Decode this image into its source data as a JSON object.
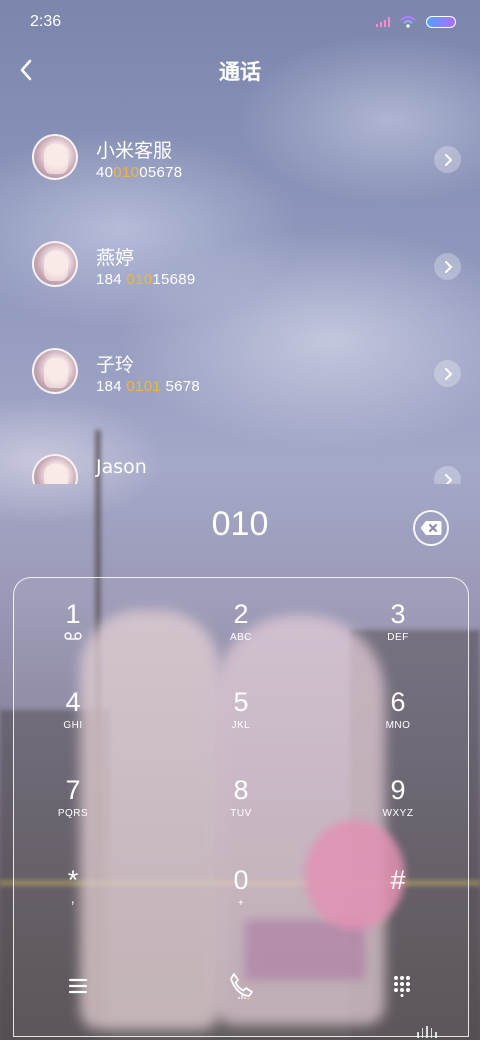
{
  "status_bar": {
    "time": "2:36"
  },
  "header": {
    "title": "通话"
  },
  "contacts": [
    {
      "name": "小米客服",
      "number_parts": [
        "40",
        "010",
        "05678"
      ]
    },
    {
      "name": "燕婷",
      "number_parts": [
        "184 ",
        "010",
        "15689"
      ]
    },
    {
      "name": "子玲",
      "number_parts": [
        "184 ",
        "0101",
        " 5678"
      ]
    },
    {
      "name": "Jason",
      "number_parts": [
        "",
        "",
        ""
      ]
    }
  ],
  "colors": {
    "highlight": "#f6b23a",
    "text": "#ffffff"
  },
  "dialer": {
    "input": "010"
  },
  "keys": [
    {
      "num": "1",
      "sub": "voicemail-icon"
    },
    {
      "num": "2",
      "sub": "ABC"
    },
    {
      "num": "3",
      "sub": "DEF"
    },
    {
      "num": "4",
      "sub": "GHI"
    },
    {
      "num": "5",
      "sub": "JKL"
    },
    {
      "num": "6",
      "sub": "MNO"
    },
    {
      "num": "7",
      "sub": "PQRS"
    },
    {
      "num": "8",
      "sub": "TUV"
    },
    {
      "num": "9",
      "sub": "WXYZ"
    },
    {
      "num": "*",
      "sub": ","
    },
    {
      "num": "0",
      "sub": "+"
    },
    {
      "num": "#",
      "sub": ""
    }
  ],
  "bottom_bar": [
    "menu-icon",
    "call-icon",
    "keypad-grid-icon"
  ]
}
